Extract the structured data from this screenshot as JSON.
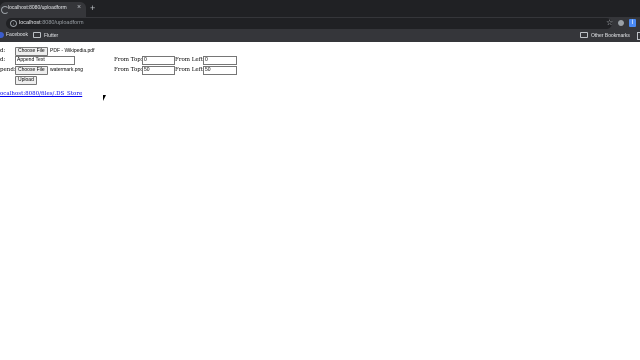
{
  "browser": {
    "tab_title": "localhost:8080/uploadform",
    "tab_close": "×",
    "new_tab": "+",
    "url_host": "localhost",
    "url_path": ":8080/uploadform",
    "profile_initial": "I",
    "bookmarks": [
      "Facebook",
      "Flutter"
    ],
    "other_bookmarks": "Other Bookmarks"
  },
  "form": {
    "row1": {
      "label": "d:",
      "button": "Choose File",
      "filename": "PDF - Wikipedia.pdf"
    },
    "row2": {
      "label": "d:",
      "text_value": "Append Text",
      "from_top_label": "From Top:",
      "from_top_value": "0",
      "from_left_label": "From Left:",
      "from_left_value": "0"
    },
    "row3": {
      "label": "pend:",
      "button": "Choose File",
      "filename": "watermark.png",
      "from_top_label": "From Top:",
      "from_top_value": "50",
      "from_left_label": "From Left:",
      "from_left_value": "50"
    },
    "upload_button": "Upload"
  },
  "link": {
    "text": "ocalhost:8080/files/.DS_Store"
  }
}
